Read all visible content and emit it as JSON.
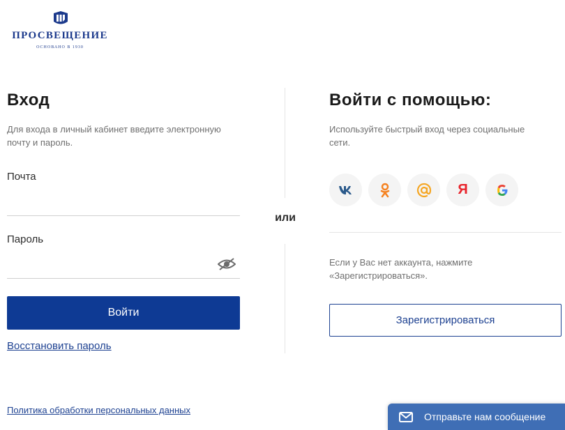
{
  "logo": {
    "name": "ПРОСВЕЩЕНИЕ",
    "tagline": "ОСНОВАНО В 1930"
  },
  "login": {
    "title": "Вход",
    "description_line1": "Для входа в личный кабинет введите электронную",
    "description_line2": "почту и пароль.",
    "email_label": "Почта",
    "email_value": "",
    "password_label": "Пароль",
    "password_value": "",
    "submit_label": "Войти",
    "restore_link": "Восстановить пароль"
  },
  "or_label": "или",
  "social": {
    "title": "Войти с помощью:",
    "description_line1": "Используйте быстрый вход через социальные",
    "description_line2": "сети.",
    "buttons": [
      {
        "icon": "vk-icon",
        "glyph": "vk",
        "color": "#2b5a8b"
      },
      {
        "icon": "odnoklassniki-icon",
        "glyph": "ok",
        "color": "#f58220"
      },
      {
        "icon": "mail-ru-icon",
        "glyph": "@",
        "color": "#f5a623"
      },
      {
        "icon": "yandex-icon",
        "glyph": "Я",
        "color": "#e8232b"
      },
      {
        "icon": "google-icon",
        "glyph": "G",
        "color": "#4285f4"
      }
    ]
  },
  "register": {
    "hint_line1": "Если у Вас нет аккаунта, нажмите",
    "hint_line2": "«Зарегистрироваться».",
    "button_label": "Зарегистрироваться"
  },
  "footer": {
    "privacy_link": "Политика обработки персональных данных"
  },
  "chat": {
    "label": "Отправьте нам сообщение"
  },
  "colors": {
    "brand": "#0e3a94",
    "link": "#1d4191",
    "chat": "#3f6eb5"
  }
}
